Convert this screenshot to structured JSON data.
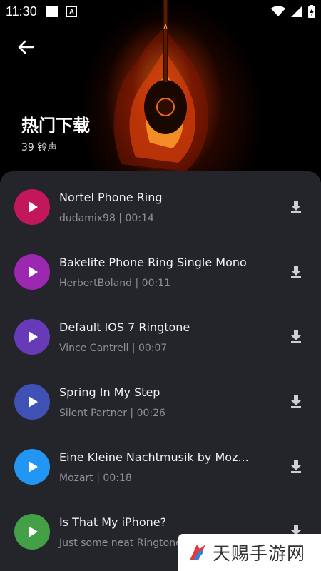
{
  "status": {
    "time": "11:30",
    "a_badge": "A"
  },
  "header": {
    "title": "热门下载",
    "count": "39 铃声"
  },
  "colors": {
    "panel_bg": "#24252b",
    "play": [
      "#c2185b",
      "#9c27b0",
      "#673ab7",
      "#3f51b5",
      "#2196f3",
      "#43a047"
    ]
  },
  "ringtones": [
    {
      "name": "Nortel Phone Ring",
      "sub": "dudamix98 | 00:14"
    },
    {
      "name": "Bakelite Phone Ring Single Mono",
      "sub": "HerbertBoland | 00:11"
    },
    {
      "name": "Default IOS 7 Ringtone",
      "sub": "Vince Cantrell | 00:07"
    },
    {
      "name": "Spring In My Step",
      "sub": "Silent Partner | 00:26"
    },
    {
      "name": "Eine Kleine Nachtmusik by Moz...",
      "sub": "Mozart | 00:18"
    },
    {
      "name": "Is That My iPhone?",
      "sub": "Just some neat Ringtone"
    }
  ],
  "watermark": {
    "text": "天赐手游网"
  }
}
